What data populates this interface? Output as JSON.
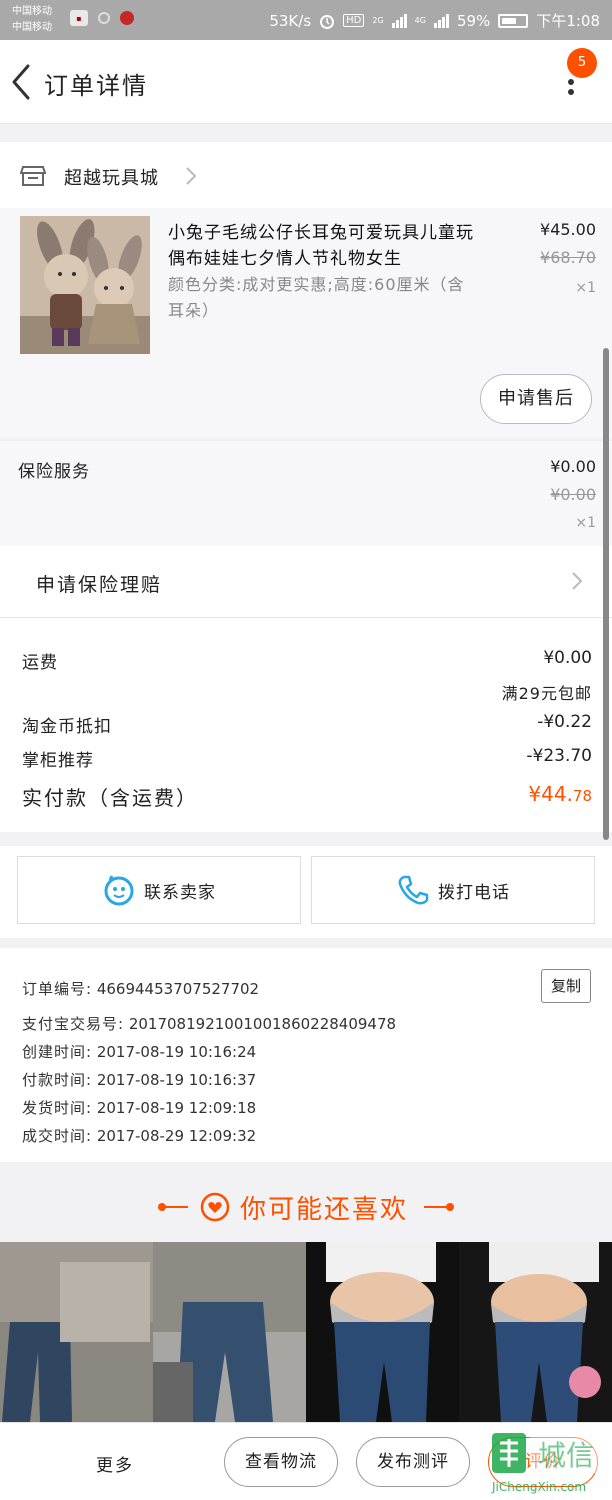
{
  "status_bar": {
    "carrier_1": "中国移动",
    "carrier_2": "中国移动",
    "net_speed": "53K/s",
    "hd": "HD",
    "net_2g": "2G",
    "net_4g": "4G",
    "battery": "59%",
    "time": "下午1:08"
  },
  "nav": {
    "title": "订单详情",
    "badge_count": "5",
    "icons": {
      "back": "chevron-left-icon",
      "more": "more-vertical-icon"
    }
  },
  "shop": {
    "name": "超越玩具城",
    "icon": "store-icon"
  },
  "item": {
    "title": "小兔子毛绒公仔长耳兔可爱玩具儿童玩偶布娃娃七夕情人节礼物女生",
    "spec": "颜色分类:成对更实惠;高度:60厘米（含耳朵）",
    "price": "¥45.00",
    "original_price": "¥68.70",
    "quantity": "×1",
    "aftersale_label": "申请售后"
  },
  "insurance": {
    "label": "保险服务",
    "price": "¥0.00",
    "original_price": "¥0.00",
    "quantity": "×1"
  },
  "claim": {
    "label": "申请保险理赔"
  },
  "summary": {
    "shipping_label": "运费",
    "shipping_value": "¥0.00",
    "free_shipping_note": "满29元包邮",
    "coin_label": "淘金币抵扣",
    "coin_value": "-¥0.22",
    "recommend_label": "掌柜推荐",
    "recommend_value": "-¥23.70",
    "total_label": "实付款（含运费）",
    "total_main": "¥44.",
    "total_decimal": "78"
  },
  "contact": {
    "seller_label": "联系卖家",
    "call_label": "拨打电话",
    "icons": {
      "seller": "chat-face-icon",
      "call": "phone-icon"
    }
  },
  "order_info": {
    "copy_label": "复制",
    "rows": [
      {
        "key": "订单编号:",
        "value": "46694453707527702"
      },
      {
        "key": "支付宝交易号:",
        "value": "2017081921001001860228409478"
      },
      {
        "key": "创建时间:",
        "value": "2017-08-19 10:16:24"
      },
      {
        "key": "付款时间:",
        "value": "2017-08-19 10:16:37"
      },
      {
        "key": "发货时间:",
        "value": "2017-08-19 12:09:18"
      },
      {
        "key": "成交时间:",
        "value": "2017-08-29 12:09:32"
      }
    ]
  },
  "recommend": {
    "title": "你可能还喜欢",
    "icon": "heart-circle-icon"
  },
  "bottom_bar": {
    "more_label": "更多",
    "logistics_label": "查看物流",
    "review_label": "发布测评",
    "rate_label": "评价"
  },
  "watermark": {
    "text": "JiChengXin.com"
  },
  "colors": {
    "accent": "#ff5000",
    "contact_icon": "#29a6e8"
  }
}
